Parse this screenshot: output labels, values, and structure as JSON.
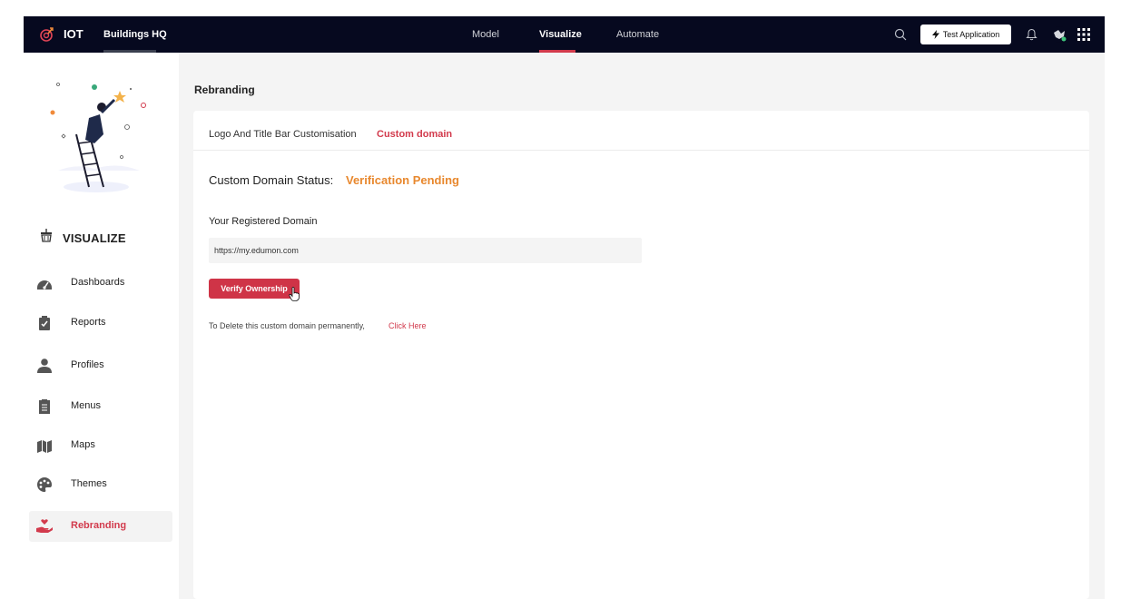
{
  "colors": {
    "topbar_bg": "#06091f",
    "accent": "#d23a4c",
    "pending": "#e8882e",
    "page_bg": "#f4f4f4"
  },
  "header": {
    "app_name": "IOT",
    "tenant": "Buildings HQ",
    "nav": [
      {
        "label": "Model",
        "active": false
      },
      {
        "label": "Visualize",
        "active": true
      },
      {
        "label": "Automate",
        "active": false
      }
    ],
    "test_button": "Test Application",
    "icons": [
      "search-icon",
      "bolt-icon",
      "bell-icon",
      "avatar",
      "apps-grid-icon"
    ]
  },
  "sidebar": {
    "section_title": "VISUALIZE",
    "items": [
      {
        "label": "Dashboards",
        "icon": "speedometer-icon",
        "active": false
      },
      {
        "label": "Reports",
        "icon": "clipboard-check-icon",
        "active": false
      },
      {
        "label": "Profiles",
        "icon": "person-icon",
        "active": false
      },
      {
        "label": "Menus",
        "icon": "menu-list-icon",
        "active": false
      },
      {
        "label": "Maps",
        "icon": "map-icon",
        "active": false
      },
      {
        "label": "Themes",
        "icon": "palette-icon",
        "active": false
      },
      {
        "label": "Rebranding",
        "icon": "hand-heart-icon",
        "active": true
      }
    ]
  },
  "main": {
    "page_title": "Rebranding",
    "tabs": [
      {
        "label": "Logo And Title Bar Customisation",
        "active": false
      },
      {
        "label": "Custom domain",
        "active": true
      }
    ],
    "status_label": "Custom Domain Status:",
    "status_value": "Verification Pending",
    "domain_label": "Your Registered Domain",
    "domain_value": "https://my.edumon.com",
    "verify_button": "Verify Ownership",
    "delete_text": "To Delete this custom domain permanently,",
    "delete_link": "Click Here"
  }
}
